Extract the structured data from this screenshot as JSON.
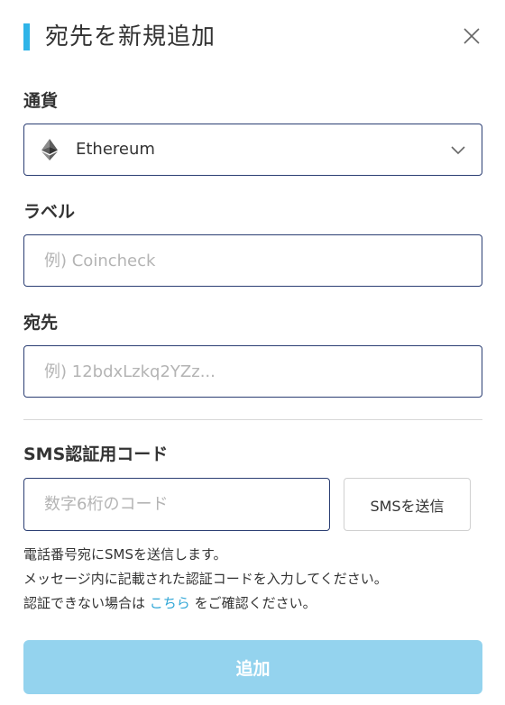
{
  "modal": {
    "title": "宛先を新規追加",
    "accent_color": "#2fb4e8",
    "close_icon": "close-icon"
  },
  "currency": {
    "label": "通貨",
    "selected": "Ethereum",
    "icon": "ethereum-icon"
  },
  "label_field": {
    "label": "ラベル",
    "placeholder": "例) Coincheck",
    "value": ""
  },
  "address_field": {
    "label": "宛先",
    "placeholder": "例) 12bdxLzkq2YZz...",
    "value": ""
  },
  "sms": {
    "label": "SMS認証用コード",
    "placeholder": "数字6桁のコード",
    "value": "",
    "send_button": "SMSを送信"
  },
  "help": {
    "line1": "電話番号宛にSMSを送信します。",
    "line2": "メッセージ内に記載された認証コードを入力してください。",
    "line3_prefix": "認証できない場合は ",
    "line3_link": "こちら",
    "line3_suffix": " をご確認ください。",
    "link_color": "#2fa6d6"
  },
  "submit": {
    "label": "追加",
    "color": "#94d3ee"
  }
}
